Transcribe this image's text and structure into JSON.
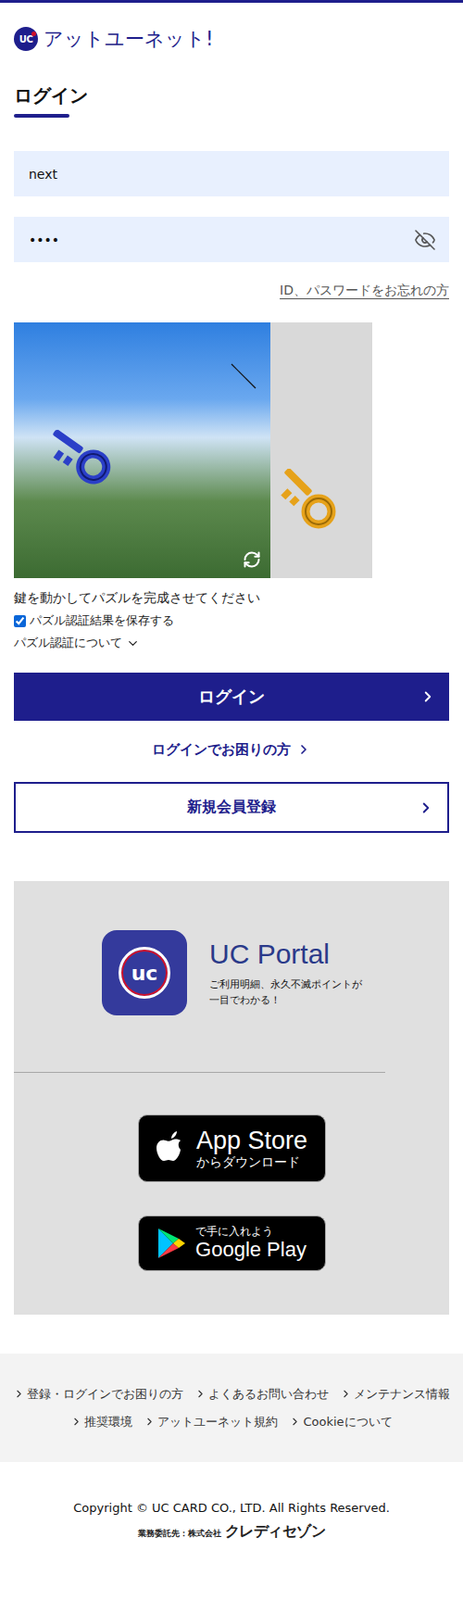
{
  "header": {
    "logo_mark": "UC",
    "logo_text": "アットユーネット!"
  },
  "login": {
    "title": "ログイン",
    "id_value": "next",
    "password_value": "••••",
    "password_visible": false,
    "forgot_link": "ID、パスワードをお忘れの方"
  },
  "puzzle": {
    "instruction": "鍵を動かしてパズルを完成させてください",
    "save_label": "パズル認証結果を保存する",
    "save_checked": true,
    "about_label": "パズル認証について",
    "about_expanded": false
  },
  "buttons": {
    "login": "ログイン",
    "help": "ログインでお困りの方",
    "register": "新規会員登録"
  },
  "app_promo": {
    "icon_text": "uc",
    "name": "UC Portal",
    "tagline": [
      "ご利用明細、永久不滅ポイントが",
      "一目でわかる！"
    ],
    "stores": [
      {
        "kind": "apple",
        "small": "からダウンロード",
        "big": "App Store"
      },
      {
        "kind": "google",
        "small": "で手に入れよう",
        "big": "Google Play"
      }
    ]
  },
  "footer": {
    "link_rows": [
      [
        "登録・ログインでお困りの方",
        "よくあるお問い合わせ",
        "メンテナンス情報"
      ],
      [
        "推奨環境",
        "アットユーネット規約",
        "Cookieについて"
      ]
    ],
    "copyright": "Copyright © UC CARD CO., LTD. All Rights Reserved.",
    "outsource_label": "業務委託先：株式会社",
    "outsource_company": "クレディセゾン"
  }
}
